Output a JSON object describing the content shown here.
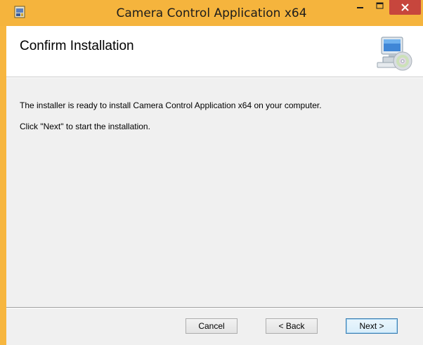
{
  "window": {
    "title": "Camera Control Application x64",
    "controls": [
      "minimize-icon",
      "maximize-icon",
      "close-icon"
    ]
  },
  "header": {
    "title": "Confirm Installation",
    "icon": "computer-cd-icon"
  },
  "body": {
    "line1": "The installer is ready to install Camera Control Application x64 on your computer.",
    "line2": "Click \"Next\" to start the installation."
  },
  "buttons": {
    "cancel": "Cancel",
    "back": "< Back",
    "next": "Next >"
  },
  "colors": {
    "titlebar": "#f5b43d",
    "close_button": "#c7463d",
    "client_bg": "#f0f0f0"
  }
}
